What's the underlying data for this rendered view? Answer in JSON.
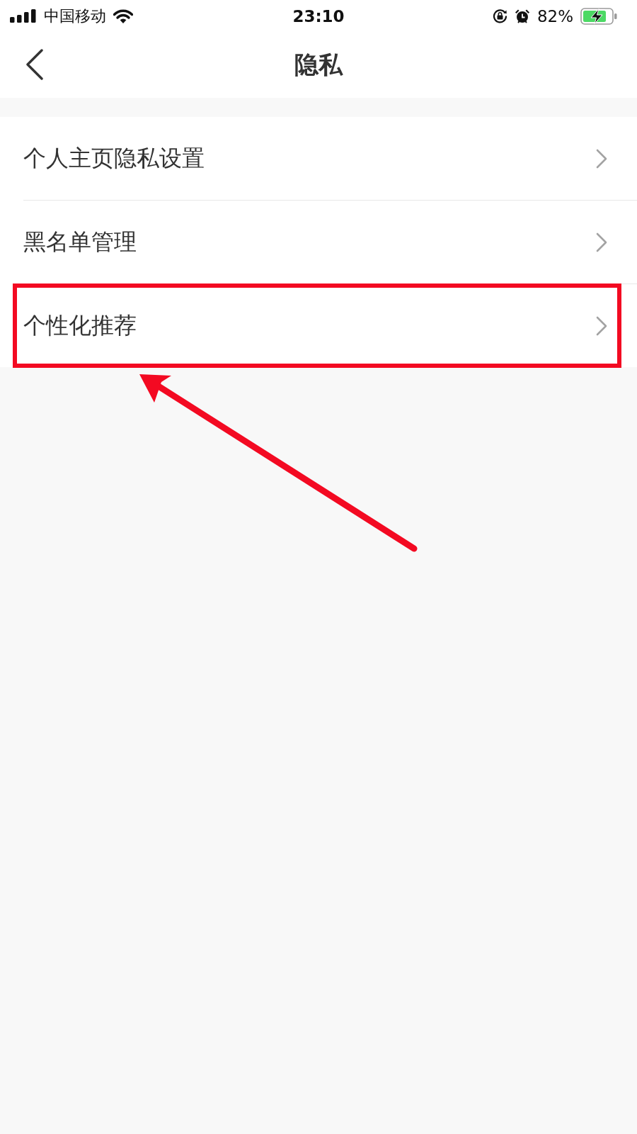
{
  "status_bar": {
    "carrier": "中国移动",
    "time": "23:10",
    "rotation_lock": true,
    "alarm": true,
    "battery_percent": "82%",
    "charging": true
  },
  "nav_bar": {
    "title": "隐私"
  },
  "items": [
    {
      "label": "个人主页隐私设置",
      "highlighted": false
    },
    {
      "label": "黑名单管理",
      "highlighted": false
    },
    {
      "label": "个性化推荐",
      "highlighted": true
    }
  ]
}
